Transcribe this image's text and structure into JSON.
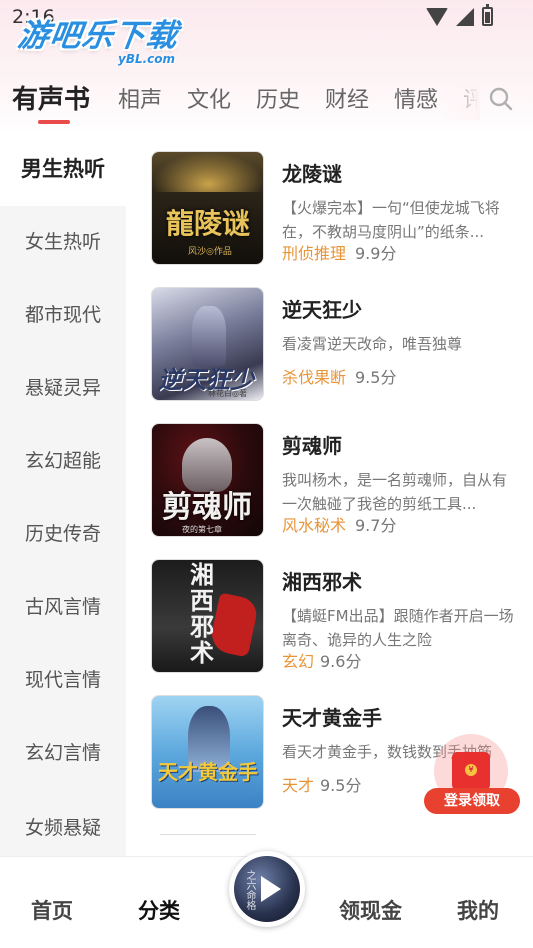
{
  "status_bar": {
    "time": "2:16"
  },
  "watermark": {
    "name": "游吧乐下载",
    "domain": "yBL.com"
  },
  "tabs": [
    {
      "label": "有声书",
      "active": true
    },
    {
      "label": "相声"
    },
    {
      "label": "文化"
    },
    {
      "label": "历史"
    },
    {
      "label": "财经"
    },
    {
      "label": "情感"
    },
    {
      "label": "评"
    }
  ],
  "sidebar": {
    "items": [
      {
        "label": "男生热听",
        "active": true
      },
      {
        "label": "女生热听"
      },
      {
        "label": "都市现代"
      },
      {
        "label": "悬疑灵异"
      },
      {
        "label": "玄幻超能"
      },
      {
        "label": "历史传奇"
      },
      {
        "label": "古风言情"
      },
      {
        "label": "现代言情"
      },
      {
        "label": "玄幻言情"
      },
      {
        "label": "女频悬疑"
      }
    ]
  },
  "books": [
    {
      "title": "龙陵谜",
      "desc": "【火爆完本】一句“但使龙城飞将在，不教胡马度阴山”的纸条...",
      "tag": "刑侦推理",
      "score": "9.9分",
      "cover_title": "龍陵谜",
      "cover_author": "风沙◎作品"
    },
    {
      "title": "逆天狂少",
      "desc": "看凌霄逆天改命，唯吾独尊",
      "tag": "杀伐果断",
      "score": "9.5分",
      "cover_title": "逆天狂少",
      "cover_author": "林花白◎著"
    },
    {
      "title": "剪魂师",
      "desc": "我叫杨木，是一名剪魂师，自从有一次触碰了我爸的剪纸工具...",
      "tag": "风水秘术",
      "score": "9.7分",
      "cover_title": "剪魂师",
      "cover_author": "夜的第七章"
    },
    {
      "title": "湘西邪术",
      "desc": "【蜻蜓FM出品】跟随作者开启一场离奇、诡异的人生之险",
      "tag": "玄幻",
      "score": "9.6分",
      "cover_title": "湘西邪术",
      "cover_author": ""
    },
    {
      "title": "天才黄金手",
      "desc": "看天才黄金手，数钱数到手抽筋",
      "tag": "天才",
      "score": "9.5分",
      "cover_title": "天才黄金手",
      "cover_author": ""
    }
  ],
  "red_packet": {
    "label": "登录领取"
  },
  "player": {
    "cover_text": "之六命格"
  },
  "bottom_nav": [
    {
      "label": "首页"
    },
    {
      "label": "分类",
      "active": true
    },
    {
      "label": "领现金"
    },
    {
      "label": "我的"
    }
  ],
  "colors": {
    "accent": "#e94b4b",
    "tag": "#e8953a",
    "packet": "#e8312f",
    "logo": "#2a8fe0"
  }
}
